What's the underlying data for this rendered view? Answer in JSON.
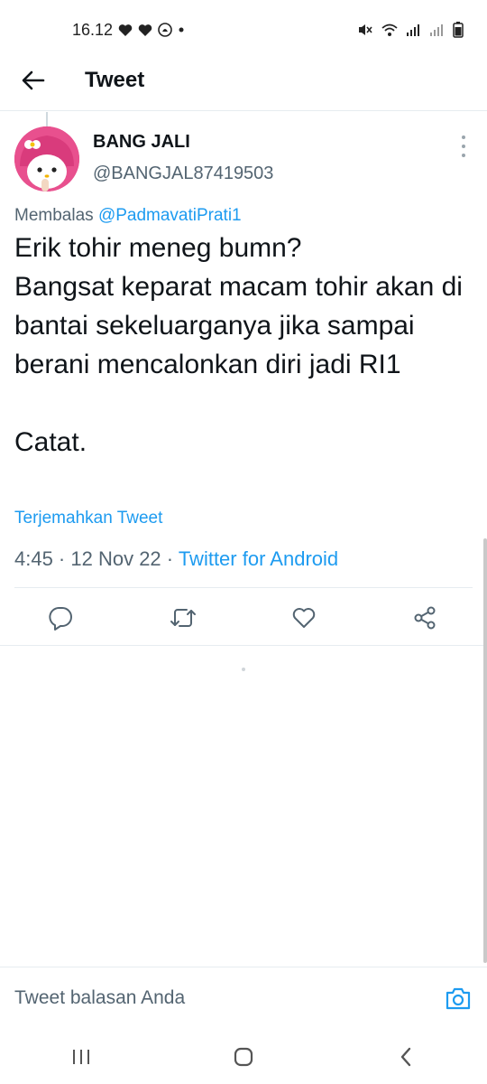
{
  "status_bar": {
    "time": "16.12"
  },
  "app_bar": {
    "title": "Tweet"
  },
  "tweet": {
    "author_name": "BANG JALI",
    "author_handle": "@BANGJAL87419503",
    "reply_prefix": "Membalas",
    "reply_to": "@PadmavatiPrati1",
    "text": "Erik tohir meneg bumn?\nBangsat keparat macam tohir akan di bantai sekeluarganya jika sampai berani mencalonkan diri jadi RI1\n\nCatat.",
    "translate_label": "Terjemahkan Tweet",
    "timestamp": "4:45 · 12 Nov 22 ·",
    "source": "Twitter for Android"
  },
  "actions": {
    "reply_icon": "reply-icon",
    "retweet_icon": "retweet-icon",
    "like_icon": "heart-icon",
    "share_icon": "share-icon"
  },
  "compose": {
    "placeholder": "Tweet balasan Anda"
  },
  "colors": {
    "accent": "#1d9bf0",
    "secondary_text": "#536471",
    "divider": "#e6ecf0"
  }
}
